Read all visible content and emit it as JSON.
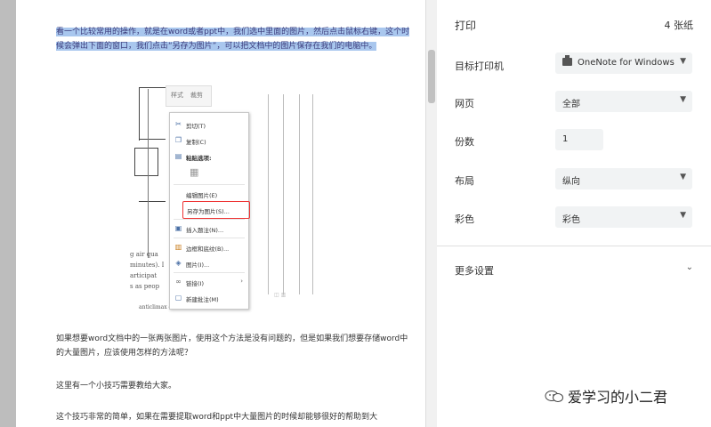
{
  "preview": {
    "selected_text": "看一个比较常用的操作，就是在word或者ppt中，我们选中里面的图片，然后点击鼠标右键，这个时候会弹出下面的窗口，我们点击“另存为图片”，可以把文档中的图片保存在我们的电脑中。",
    "para2": "如果想要word文档中的一张两张图片，使用这个方法是没有问题的，但是如果我们想要存储word中的大量图片，应该使用怎样的方法呢？",
    "para3": "这里有一个小技巧需要教给大家。",
    "para4": "这个技巧非常的简单，如果在需要提取word和ppt中大量图片的时候却能够很好的帮助到大",
    "context_header": [
      "样式",
      "裁剪"
    ],
    "context_menu": [
      {
        "label": "剪切(T)",
        "icon": "scissors-icon"
      },
      {
        "label": "复制(C)",
        "icon": "copy-icon"
      },
      {
        "label": "粘贴选项:",
        "icon": "paste-icon"
      },
      {
        "label": "编辑图片(E)",
        "icon": ""
      },
      {
        "label": "另存为图片(S)...",
        "icon": ""
      },
      {
        "label": "插入题注(N)...",
        "icon": "caption-icon"
      },
      {
        "label": "边框和底纹(B)...",
        "icon": "border-icon"
      },
      {
        "label": "图片(I)...",
        "icon": "picture-icon"
      },
      {
        "label": "链接(I)",
        "icon": "link-icon"
      },
      {
        "label": "新建批注(M)",
        "icon": "comment-icon"
      }
    ],
    "fragments": [
      "g air qua",
      "minutes). I",
      "articipat",
      "s as peop",
      "anticlimax of the deserved"
    ]
  },
  "panel": {
    "title": "打印",
    "sheet_count": "4 张纸",
    "destination_label": "目标打印机",
    "destination_value": "OneNote for Windows",
    "pages_label": "网页",
    "pages_value": "全部",
    "copies_label": "份数",
    "copies_value": "1",
    "layout_label": "布局",
    "layout_value": "纵向",
    "color_label": "彩色",
    "color_value": "彩色",
    "more_settings": "更多设置"
  },
  "watermark": "爱学习的小二君",
  "colors": {
    "accent": "#e33333",
    "selection": "#a9c7ee",
    "field_bg": "#f1f3f4"
  }
}
